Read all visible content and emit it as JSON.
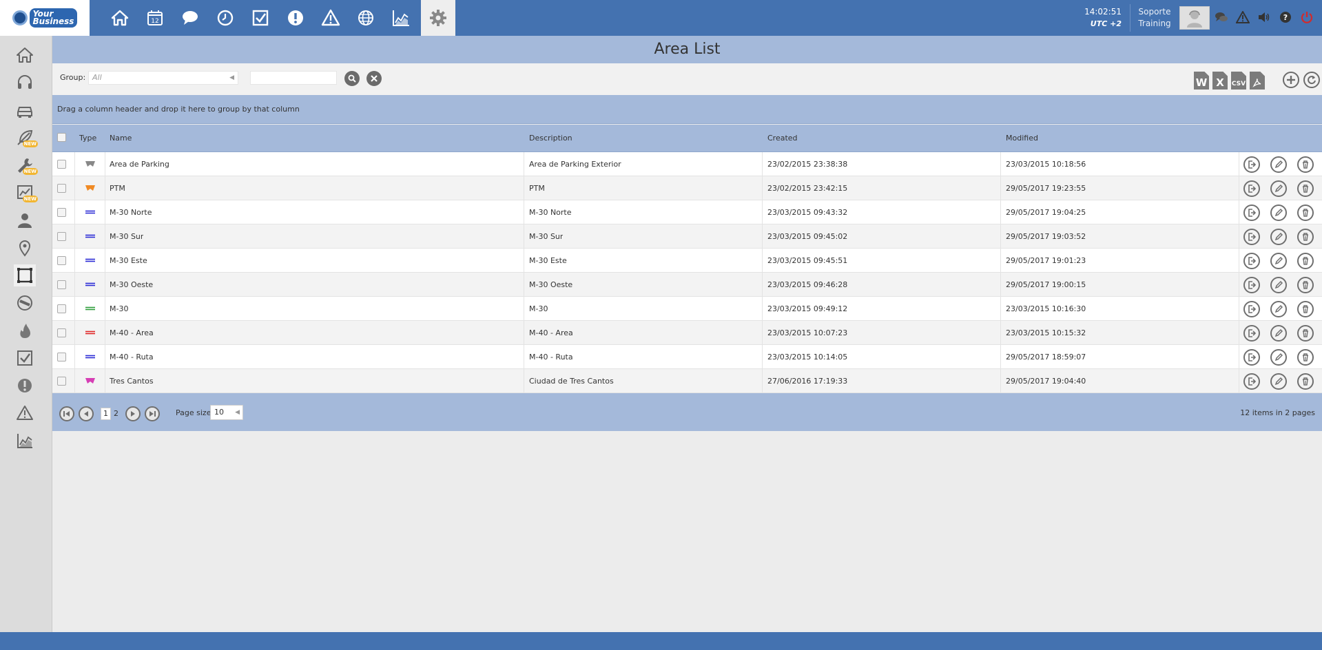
{
  "brand": {
    "logo_text_line1": "Your",
    "logo_text_line2": "Business"
  },
  "topnav": {
    "items": [
      {
        "icon": "home-icon"
      },
      {
        "icon": "calendar-icon",
        "label": "12"
      },
      {
        "icon": "chat-icon"
      },
      {
        "icon": "clock-icon"
      },
      {
        "icon": "checkbox-icon"
      },
      {
        "icon": "alert-circle-icon"
      },
      {
        "icon": "warning-icon"
      },
      {
        "icon": "globe-icon"
      },
      {
        "icon": "chart-icon"
      },
      {
        "icon": "gear-icon",
        "active": true
      }
    ]
  },
  "clock": {
    "time": "14:02:51",
    "timezone": "UTC +2"
  },
  "user": {
    "line1": "Soporte",
    "line2": "Training"
  },
  "sidebar": {
    "items": [
      {
        "icon": "home-icon"
      },
      {
        "icon": "headset-icon"
      },
      {
        "icon": "car-icon"
      },
      {
        "icon": "feather-icon",
        "badge": "NEW"
      },
      {
        "icon": "wrench-icon",
        "badge": "NEW"
      },
      {
        "icon": "chart-board-icon",
        "badge": "NEW"
      },
      {
        "icon": "person-icon"
      },
      {
        "icon": "location-pin-icon"
      },
      {
        "icon": "area-square-icon",
        "active": true
      },
      {
        "icon": "no-entry-icon"
      },
      {
        "icon": "flame-icon"
      },
      {
        "icon": "checkbox-icon"
      },
      {
        "icon": "alert-circle-icon"
      },
      {
        "icon": "warning-icon"
      },
      {
        "icon": "chart-icon"
      }
    ]
  },
  "page": {
    "title": "Area List"
  },
  "toolbar": {
    "group_label": "Group:",
    "group_value": "All",
    "search_value": "",
    "exports": [
      "W",
      "X",
      "CSV",
      "PDF"
    ]
  },
  "grid": {
    "group_hint": "Drag a column header and drop it here to group by that column",
    "columns": {
      "type": "Type",
      "name": "Name",
      "description": "Description",
      "created": "Created",
      "modified": "Modified"
    },
    "rows": [
      {
        "type": "polygon",
        "color": "#888888",
        "name": "Area de Parking",
        "description": "Area de Parking Exterior",
        "created": "23/02/2015 23:38:38",
        "modified": "23/03/2015 10:18:56"
      },
      {
        "type": "polygon",
        "color": "#f08a24",
        "name": "PTM",
        "description": "PTM",
        "created": "23/02/2015 23:42:15",
        "modified": "29/05/2017 19:23:55"
      },
      {
        "type": "route",
        "color": "#2b2bd6",
        "name": "M-30 Norte",
        "description": "M-30 Norte",
        "created": "23/03/2015 09:43:32",
        "modified": "29/05/2017 19:04:25"
      },
      {
        "type": "route",
        "color": "#2b2bd6",
        "name": "M-30 Sur",
        "description": "M-30 Sur",
        "created": "23/03/2015 09:45:02",
        "modified": "29/05/2017 19:03:52"
      },
      {
        "type": "route",
        "color": "#2b2bd6",
        "name": "M-30 Este",
        "description": "M-30 Este",
        "created": "23/03/2015 09:45:51",
        "modified": "29/05/2017 19:01:23"
      },
      {
        "type": "route",
        "color": "#2b2bd6",
        "name": "M-30 Oeste",
        "description": "M-30 Oeste",
        "created": "23/03/2015 09:46:28",
        "modified": "29/05/2017 19:00:15"
      },
      {
        "type": "route",
        "color": "#2e9e3a",
        "name": "M-30",
        "description": "M-30",
        "created": "23/03/2015 09:49:12",
        "modified": "23/03/2015 10:16:30"
      },
      {
        "type": "route",
        "color": "#e02525",
        "name": "M-40 - Area",
        "description": "M-40 - Area",
        "created": "23/03/2015 10:07:23",
        "modified": "23/03/2015 10:15:32"
      },
      {
        "type": "route",
        "color": "#2b2bd6",
        "name": "M-40 - Ruta",
        "description": "M-40 - Ruta",
        "created": "23/03/2015 10:14:05",
        "modified": "29/05/2017 18:59:07"
      },
      {
        "type": "polygon",
        "color": "#d63fb5",
        "name": "Tres Cantos",
        "description": "Ciudad de Tres Cantos",
        "created": "27/06/2016 17:19:33",
        "modified": "29/05/2017 19:04:40"
      }
    ]
  },
  "pager": {
    "pages": [
      "1",
      "2"
    ],
    "current_page": "1",
    "page_size_label": "Page size:",
    "page_size": "10",
    "info": "12 items in 2 pages"
  }
}
